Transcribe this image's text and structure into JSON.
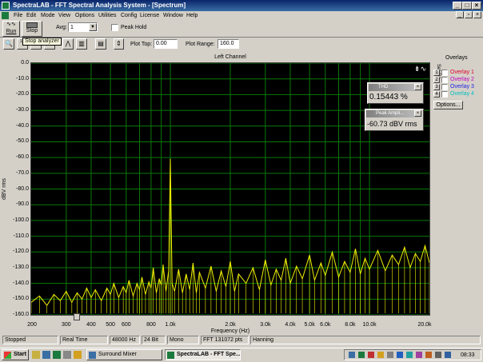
{
  "window": {
    "title": "SpectraLAB - FFT Spectral Analysis System - [Spectrum]"
  },
  "menu": [
    "File",
    "Edit",
    "Mode",
    "View",
    "Options",
    "Utilities",
    "Config",
    "License",
    "Window",
    "Help"
  ],
  "toolbar": {
    "run_label": "Run",
    "stop_label": "Stop",
    "avg_label": "Avg:",
    "avg_value": "1",
    "peak_hold_label": "Peak Hold",
    "tooltip": "Stop analyzer",
    "plot_top_label": "Plot Top:",
    "plot_top_value": "0.00",
    "plot_range_label": "Plot Range:",
    "plot_range_value": "160.0"
  },
  "overlays": {
    "title": "Overlays",
    "set_on_label": "Set On",
    "items": [
      {
        "num": "1",
        "label": "Overlay 1",
        "color": "#e0002a"
      },
      {
        "num": "2",
        "label": "Overlay 2",
        "color": "#c000c0"
      },
      {
        "num": "3",
        "label": "Overlay 3",
        "color": "#2020e0"
      },
      {
        "num": "4",
        "label": "Overlay 4",
        "color": "#00c0c0"
      }
    ],
    "options_label": "Options..."
  },
  "thd_window": {
    "title": "THD",
    "value": "0.15443 %"
  },
  "peak_window": {
    "title": "Peak Ampli...",
    "value": "-60.73 dBV rms"
  },
  "colors": {
    "trace": "#f0f000",
    "grid": "#0a7a0a",
    "background": "#000000"
  },
  "chart_data": {
    "type": "line",
    "title": "Left Channel",
    "xlabel": "Frequency (Hz)",
    "ylabel": "dBV rms",
    "x_scale": "log",
    "xlim": [
      200,
      20000
    ],
    "ylim": [
      -160,
      0
    ],
    "x_ticks": [
      {
        "v": 200,
        "label": "200"
      },
      {
        "v": 300,
        "label": "300"
      },
      {
        "v": 400,
        "label": "400"
      },
      {
        "v": 500,
        "label": "500"
      },
      {
        "v": 600,
        "label": "600"
      },
      {
        "v": 800,
        "label": "800"
      },
      {
        "v": 1000,
        "label": "1.0k"
      },
      {
        "v": 2000,
        "label": "2.0k"
      },
      {
        "v": 3000,
        "label": "3.0k"
      },
      {
        "v": 4000,
        "label": "4.0k"
      },
      {
        "v": 5000,
        "label": "5.0k"
      },
      {
        "v": 6000,
        "label": "6.0k"
      },
      {
        "v": 8000,
        "label": "8.0k"
      },
      {
        "v": 10000,
        "label": "10.0k"
      },
      {
        "v": 20000,
        "label": "20.0k"
      }
    ],
    "y_ticks": [
      "0.0",
      "-10.0",
      "-20.0",
      "-30.0",
      "-40.0",
      "-50.0",
      "-60.0",
      "-70.0",
      "-80.0",
      "-90.0",
      "-100.0",
      "-110.0",
      "-120.0",
      "-130.0",
      "-140.0",
      "-150.0",
      "-160.0"
    ],
    "grid": true,
    "series": [
      {
        "peak": {
          "x": 1000,
          "y": -60.7
        },
        "points": [
          [
            200,
            -152
          ],
          [
            220,
            -148
          ],
          [
            240,
            -154
          ],
          [
            260,
            -147
          ],
          [
            280,
            -151
          ],
          [
            300,
            -145
          ],
          [
            320,
            -152
          ],
          [
            340,
            -146
          ],
          [
            360,
            -150
          ],
          [
            380,
            -143
          ],
          [
            400,
            -149
          ],
          [
            420,
            -144
          ],
          [
            450,
            -151
          ],
          [
            480,
            -143
          ],
          [
            500,
            -147
          ],
          [
            520,
            -140
          ],
          [
            550,
            -149
          ],
          [
            580,
            -142
          ],
          [
            600,
            -146
          ],
          [
            620,
            -138
          ],
          [
            650,
            -148
          ],
          [
            680,
            -140
          ],
          [
            700,
            -144
          ],
          [
            720,
            -136
          ],
          [
            750,
            -147
          ],
          [
            780,
            -139
          ],
          [
            800,
            -143
          ],
          [
            820,
            -130
          ],
          [
            850,
            -146
          ],
          [
            880,
            -137
          ],
          [
            900,
            -141
          ],
          [
            920,
            -128
          ],
          [
            950,
            -145
          ],
          [
            980,
            -132
          ],
          [
            1000,
            -60.7
          ],
          [
            1020,
            -140
          ],
          [
            1050,
            -145
          ],
          [
            1100,
            -131
          ],
          [
            1150,
            -146
          ],
          [
            1200,
            -134
          ],
          [
            1250,
            -144
          ],
          [
            1300,
            -127
          ],
          [
            1350,
            -146
          ],
          [
            1400,
            -133
          ],
          [
            1500,
            -143
          ],
          [
            1600,
            -129
          ],
          [
            1700,
            -145
          ],
          [
            1800,
            -132
          ],
          [
            1900,
            -142
          ],
          [
            2000,
            -126
          ],
          [
            2100,
            -145
          ],
          [
            2200,
            -134
          ],
          [
            2400,
            -140
          ],
          [
            2600,
            -130
          ],
          [
            2800,
            -144
          ],
          [
            3000,
            -125
          ],
          [
            3200,
            -141
          ],
          [
            3400,
            -131
          ],
          [
            3600,
            -138
          ],
          [
            3800,
            -124
          ],
          [
            4000,
            -140
          ],
          [
            4300,
            -129
          ],
          [
            4600,
            -137
          ],
          [
            5000,
            -122
          ],
          [
            5300,
            -138
          ],
          [
            5700,
            -127
          ],
          [
            6000,
            -135
          ],
          [
            6500,
            -120
          ],
          [
            7000,
            -136
          ],
          [
            7500,
            -126
          ],
          [
            8000,
            -133
          ],
          [
            8500,
            -118
          ],
          [
            9000,
            -134
          ],
          [
            9500,
            -124
          ],
          [
            10000,
            -131
          ],
          [
            11000,
            -119
          ],
          [
            12000,
            -132
          ],
          [
            13000,
            -122
          ],
          [
            14000,
            -128
          ],
          [
            15000,
            -117
          ],
          [
            16000,
            -130
          ],
          [
            17000,
            -121
          ],
          [
            18000,
            -126
          ],
          [
            19000,
            -116
          ],
          [
            20000,
            -127
          ]
        ]
      }
    ]
  },
  "status": {
    "state": "Stopped",
    "mode": "Real Time",
    "rate": "48000 Hz",
    "bits": "24 Bit",
    "channels": "Mono",
    "fft": "FFT 131072 pts",
    "window": "Hanning"
  },
  "taskbar": {
    "start_label": "Start",
    "tasks": [
      "Surround Mixer",
      "SpectraLAB - FFT Spe..."
    ],
    "clock": "08:33"
  }
}
